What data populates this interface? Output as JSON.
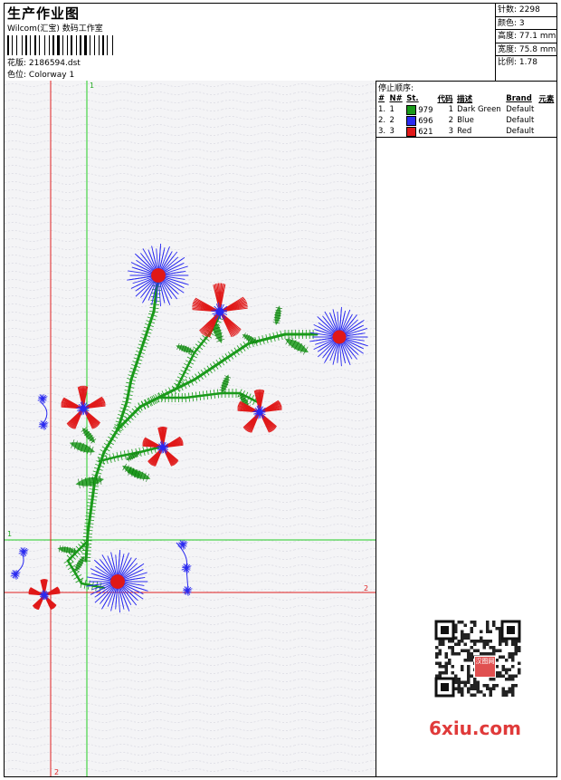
{
  "header": {
    "title": "生产作业图",
    "subtitle": "Wilcom(汇宝) 数码工作室",
    "design_label": "花版:",
    "design_value": "2186594.dst",
    "colorway_label": "色位:",
    "colorway_value": "Colorway 1"
  },
  "stats": [
    {
      "label": "针数:",
      "value": "2298"
    },
    {
      "label": "颜色:",
      "value": "3"
    },
    {
      "label": "高度:",
      "value": "77.1 mm"
    },
    {
      "label": "宽度:",
      "value": "75.8 mm"
    },
    {
      "label": "比例:",
      "value": "1.78"
    }
  ],
  "stop_sequence": {
    "title": "停止顺序:",
    "headers": [
      "#",
      "N#",
      "St.",
      "代码",
      "描述",
      "Brand",
      "元素"
    ],
    "rows": [
      {
        "idx": "1.",
        "n": "1",
        "color": "#1a9a1a",
        "st": "979",
        "code": "1",
        "desc": "Dark Green",
        "brand": "Default"
      },
      {
        "idx": "2.",
        "n": "2",
        "color": "#2a2af0",
        "st": "696",
        "code": "2",
        "desc": "Blue",
        "brand": "Default"
      },
      {
        "idx": "3.",
        "n": "3",
        "color": "#e01818",
        "st": "621",
        "code": "3",
        "desc": "Red",
        "brand": "Default"
      }
    ]
  },
  "guides": {
    "green_v_label": "1",
    "green_h_label": "1",
    "red_h_label": "2",
    "red_v_label": "2"
  },
  "watermark": {
    "qr_label": "汉图网",
    "site": "6xiu.com"
  },
  "colors": {
    "green": "#1a9a1a",
    "blue": "#2a2af0",
    "red": "#e01818",
    "guide_green": "#22cc22",
    "guide_red": "#e02020"
  }
}
